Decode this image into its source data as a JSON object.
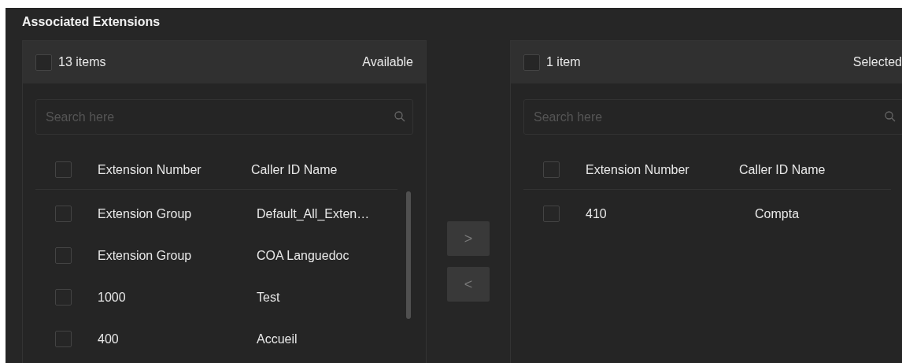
{
  "section_title": "Associated Extensions",
  "panels": [
    {
      "count": "13 items",
      "label": "Available",
      "all_checked": false,
      "search": {
        "placeholder": "Search here"
      },
      "columns": [
        "Extension Number",
        "Caller ID Name"
      ],
      "header_checked": false,
      "scrollbar": true,
      "rows": [
        {
          "number": "Extension Group",
          "name": "Default_All_Exten…",
          "checked": false
        },
        {
          "number": "Extension Group",
          "name": "COA Languedoc",
          "checked": false
        },
        {
          "number": "1000",
          "name": "Test",
          "checked": false
        },
        {
          "number": "400",
          "name": "Accueil",
          "checked": false
        }
      ]
    },
    {
      "count": "1 item",
      "label": "Selected",
      "all_checked": false,
      "search": {
        "placeholder": "Search here"
      },
      "columns": [
        "Extension Number",
        "Caller ID Name"
      ],
      "header_checked": false,
      "scrollbar": false,
      "rows": [
        {
          "number": "410",
          "name": "Compta",
          "checked": false
        }
      ]
    }
  ],
  "transfer_buttons": [
    {
      "glyph": ">",
      "disabled": true
    },
    {
      "glyph": "<",
      "disabled": true
    }
  ]
}
